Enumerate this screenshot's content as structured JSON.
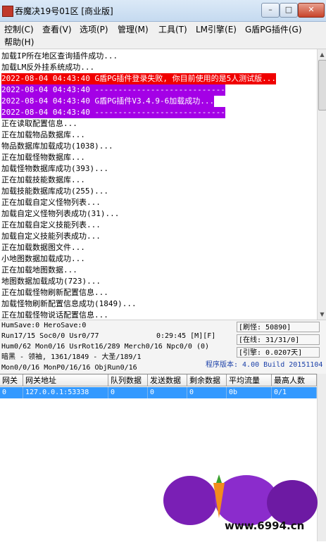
{
  "window": {
    "title": "吞魔决19号01区 [商业版]"
  },
  "menu": [
    {
      "label": "控制(C)"
    },
    {
      "label": "查看(V)"
    },
    {
      "label": "选项(P)"
    },
    {
      "label": "管理(M)"
    },
    {
      "label": "工具(T)"
    },
    {
      "label": "LM引擎(E)"
    },
    {
      "label": "G盾PG插件(G)"
    },
    {
      "label": "帮助(H)"
    }
  ],
  "log": [
    {
      "text": "加载IP所在地区查询插件成功...",
      "style": "normal"
    },
    {
      "text": "加载LM反外挂系统成功...",
      "style": "normal"
    },
    {
      "text": "2022-08-04 04:43:40 G盾PG插件登录失败, 你目前使用的是5人测试版...",
      "style": "red"
    },
    {
      "text": "2022-08-04 04:43:40 ----------------------------",
      "style": "purple"
    },
    {
      "text": "2022-08-04 04:43:40 G盾PG插件V3.4.9-6加载成功...",
      "style": "purple"
    },
    {
      "text": "2022-08-04 04:43:40 ----------------------------",
      "style": "purple"
    },
    {
      "text": "正在读取配置信息...",
      "style": "normal"
    },
    {
      "text": "正在加载物品数据库...",
      "style": "normal"
    },
    {
      "text": "物品数据库加载成功(1038)...",
      "style": "normal"
    },
    {
      "text": "正在加载怪物数据库...",
      "style": "normal"
    },
    {
      "text": "加载怪物数据库成功(393)...",
      "style": "normal"
    },
    {
      "text": "正在加载技能数据库...",
      "style": "normal"
    },
    {
      "text": "加载技能数据库成功(255)...",
      "style": "normal"
    },
    {
      "text": "正在加载自定义怪物列表...",
      "style": "normal"
    },
    {
      "text": "加载自定义怪物列表成功(31)...",
      "style": "normal"
    },
    {
      "text": "正在加载自定义技能列表...",
      "style": "normal"
    },
    {
      "text": "加载自定义技能列表成功...",
      "style": "normal"
    },
    {
      "text": "正在加载数据图文件...",
      "style": "normal"
    },
    {
      "text": "小地图数据加载成功...",
      "style": "normal"
    },
    {
      "text": "正在加载地图数据...",
      "style": "normal"
    },
    {
      "text": "地图数据加载成功(723)...",
      "style": "normal"
    },
    {
      "text": "正在加载怪物刷新配置信息...",
      "style": "normal"
    },
    {
      "text": "加载怪物刷新配置信息成功(1849)...",
      "style": "normal"
    },
    {
      "text": "正在加载怪物说话配置信息...",
      "style": "normal"
    }
  ],
  "status": {
    "line1": "HumSave:0 HeroSave:0",
    "line2_left": "Run17/15 Soc0/0 Usr0/77",
    "line2_time": "0:29:45 [M][F]",
    "line3": "Hum0/62 Mon0/16 UsrRot16/289 Merch0/16 Npc0/0 (0)",
    "line4": "暗黑 - 领袖, 1361/1849 - 大圣/189/1",
    "line5": "Mon0/0/16 MonP0/16/16 ObjRun0/16",
    "box_refresh": "[刷怪: 50890]",
    "box_online": "[在线: 31/31/0]",
    "box_engine": "[引擎: 0.0207天]",
    "version": "程序版本: 4.00 Build 20151104"
  },
  "grid": {
    "columns": [
      "网关",
      "网关地址",
      "队列数据",
      "发送数据",
      "剩余数据",
      "平均流量",
      "最高人数"
    ],
    "rows": [
      [
        "0",
        "127.0.0.1:53338",
        "0",
        "0",
        "0",
        "0b",
        "0/1"
      ]
    ]
  },
  "watermark": {
    "url": "www.6994.cn"
  },
  "colors": {
    "error_bg": "#f00000",
    "plugin_bg": "#a400e6",
    "selection": "#3399ff"
  }
}
